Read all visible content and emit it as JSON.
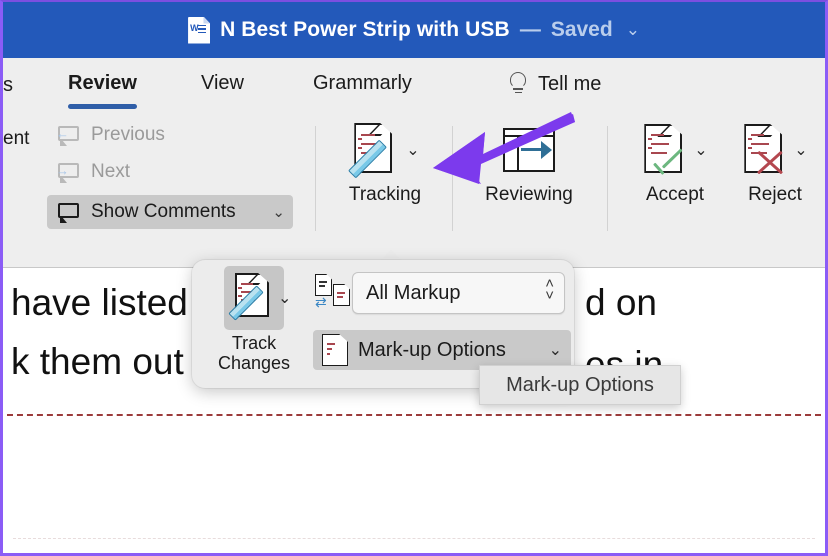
{
  "titlebar": {
    "app_icon": "word-document-icon",
    "document_title": "N Best Power Strip with USB",
    "separator": "—",
    "save_state": "Saved",
    "chevron": "⌄",
    "background_color": "#2359ba"
  },
  "ribbon": {
    "tabs": [
      {
        "label": "s",
        "active": false,
        "partial": true
      },
      {
        "label": "Review",
        "active": true
      },
      {
        "label": "View",
        "active": false
      },
      {
        "label": "Grammarly",
        "active": false
      },
      {
        "label": "Tell me",
        "active": false,
        "icon": "lightbulb-icon"
      }
    ],
    "active_tab_accent": "#2f5ea8",
    "comments_group": {
      "partial_label": "ent",
      "items": [
        {
          "label": "Previous",
          "icon": "previous-comment-icon",
          "enabled": false
        },
        {
          "label": "Next",
          "icon": "next-comment-icon",
          "enabled": false
        },
        {
          "label": "Show Comments",
          "icon": "comment-icon",
          "enabled": true,
          "highlighted": true,
          "chevron": "⌄"
        }
      ]
    },
    "buttons": [
      {
        "label": "Tracking",
        "icon": "document-pencil-icon",
        "chevron": "⌄",
        "has_chevron": true
      },
      {
        "label": "Reviewing",
        "icon": "reviewing-pane-icon",
        "has_chevron": false
      },
      {
        "label": "Accept",
        "icon": "document-check-icon",
        "chevron": "⌄",
        "has_chevron": true
      },
      {
        "label": "Reject",
        "icon": "document-x-icon",
        "chevron": "⌄",
        "has_chevron": true
      }
    ]
  },
  "tracking_popup": {
    "track_changes": {
      "label_line1": "Track",
      "label_line2": "Changes",
      "icon": "document-pencil-icon",
      "chevron": "⌄",
      "active": true
    },
    "markup_select": {
      "icon": "compare-markup-icon",
      "value": "All Markup",
      "stepper_up": "˄",
      "stepper_down": "˅"
    },
    "markup_options": {
      "icon": "markup-document-icon",
      "label": "Mark-up Options",
      "chevron": "⌄",
      "hovered": true
    }
  },
  "tooltip": {
    "text": "Mark-up Options"
  },
  "document": {
    "line1": "have listed",
    "line1_right": "d on",
    "line2": "k them out",
    "line2_right": "es in"
  },
  "annotation": {
    "arrow_color": "#7c3aed",
    "points_to": "tracking-dropdown-chevron"
  },
  "colors": {
    "title_bar": "#2359ba",
    "ribbon_bg": "#eeeeee",
    "accent": "#2f5ea8",
    "highlight": "#c9c9c9",
    "frame_border": "#8b5cf6",
    "markup_red": "#a8474f",
    "accept_green": "#6cb77f",
    "reject_red": "#b4474f"
  }
}
